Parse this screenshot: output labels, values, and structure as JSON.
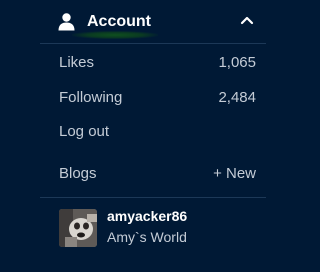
{
  "account_menu": {
    "header": {
      "label": "Account",
      "icon": "user-icon",
      "toggle_icon": "chevron-up-icon"
    },
    "items": [
      {
        "label": "Likes",
        "value": "1,065"
      },
      {
        "label": "Following",
        "value": "2,484"
      },
      {
        "label": "Log out"
      }
    ],
    "blogs": {
      "label": "Blogs",
      "new_label": "+ New",
      "list": [
        {
          "name": "amyacker86",
          "title": "Amy`s World",
          "avatar_icon": "blog-avatar"
        }
      ]
    }
  },
  "colors": {
    "background": "#001935",
    "primary_text": "#ffffff",
    "secondary_text": "#c4ccd6",
    "divider": "#1c3857"
  }
}
